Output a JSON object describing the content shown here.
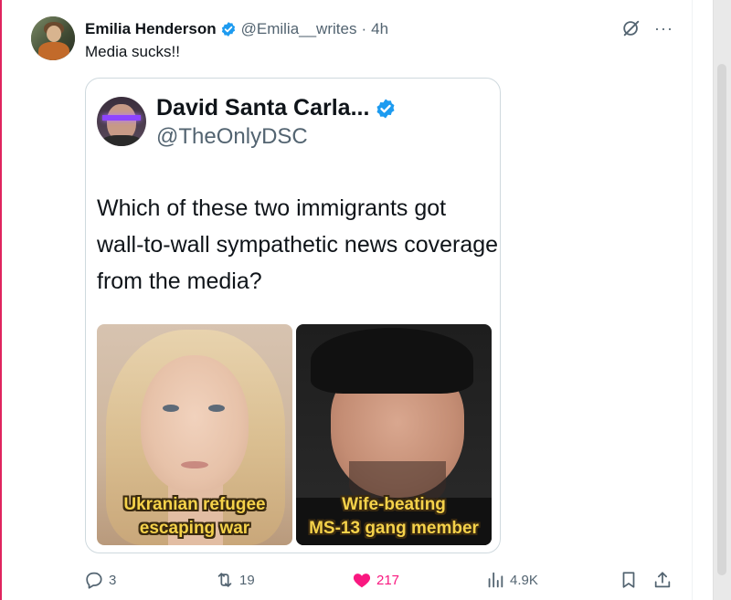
{
  "tweet": {
    "author_name": "Emilia Henderson",
    "author_handle": "@Emilia__writes",
    "separator": "·",
    "time": "4h",
    "text": "Media sucks!!",
    "more_label": "···"
  },
  "quoted": {
    "author_name": "David Santa Carla...",
    "author_handle": "@TheOnlyDSC",
    "text": "Which of these two immigrants got wall-to-wall sympathetic news coverage from the media?",
    "images": [
      {
        "caption_line1": "Ukranian refugee",
        "caption_line2": "escaping war"
      },
      {
        "caption_line1": "Wife-beating",
        "caption_line2": "MS-13 gang member"
      }
    ]
  },
  "actions": {
    "replies": "3",
    "retweets": "19",
    "likes": "217",
    "views": "4.9K"
  },
  "colors": {
    "verified": "#1d9bf0",
    "like": "#f91880",
    "secondary_text": "#536471",
    "caption_text": "#f5d24a"
  },
  "icons": [
    "verified-badge-icon",
    "grok-icon",
    "more-icon",
    "reply-icon",
    "retweet-icon",
    "heart-icon",
    "views-icon",
    "bookmark-icon",
    "share-icon"
  ]
}
